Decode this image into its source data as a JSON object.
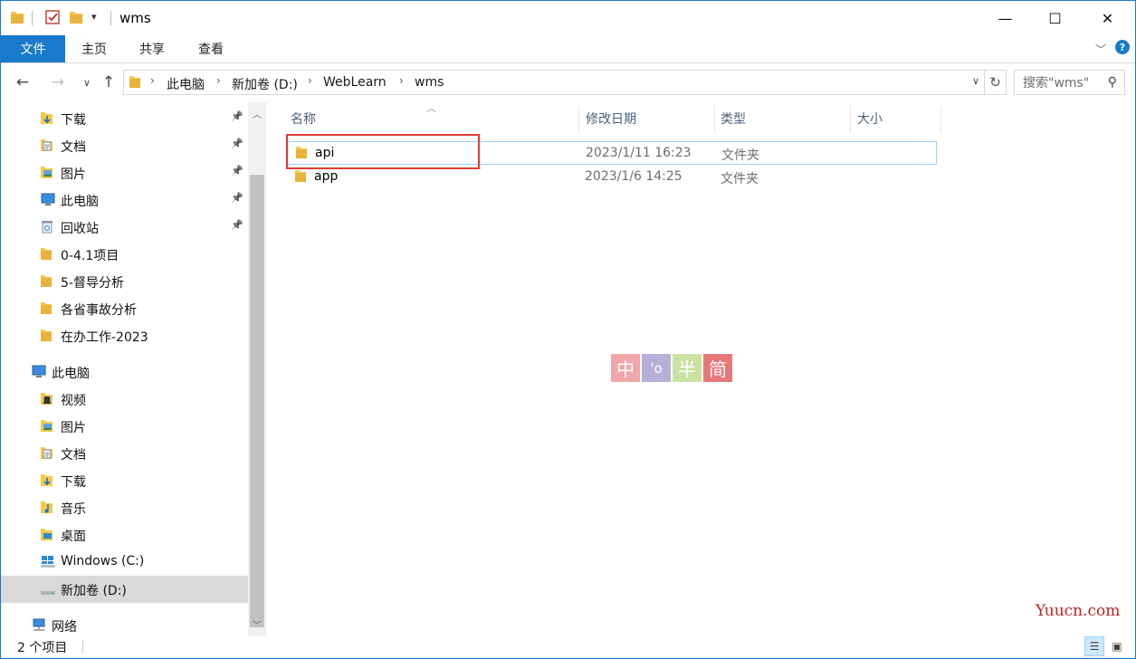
{
  "window": {
    "title": "wms",
    "controls": {
      "minimize": "—",
      "maximize": "☐",
      "close": "✕"
    }
  },
  "ribbon": {
    "tabs": [
      {
        "label": "文件",
        "active": true
      },
      {
        "label": "主页"
      },
      {
        "label": "共享"
      },
      {
        "label": "查看"
      }
    ]
  },
  "address": {
    "crumbs": [
      "此电脑",
      "新加卷 (D:)",
      "WebLearn",
      "wms"
    ],
    "search_placeholder": "搜索\"wms\""
  },
  "nav_pane": {
    "items": [
      {
        "label": "下载",
        "icon": "download-folder-icon",
        "pinned": true,
        "indent": 1
      },
      {
        "label": "文档",
        "icon": "documents-icon",
        "pinned": true,
        "indent": 1
      },
      {
        "label": "图片",
        "icon": "pictures-icon",
        "pinned": true,
        "indent": 1
      },
      {
        "label": "此电脑",
        "icon": "this-pc-icon",
        "pinned": true,
        "indent": 1
      },
      {
        "label": "回收站",
        "icon": "recycle-bin-icon",
        "pinned": true,
        "indent": 1
      },
      {
        "label": "0-4.1项目",
        "icon": "folder-icon",
        "indent": 1
      },
      {
        "label": "5-督导分析",
        "icon": "folder-icon",
        "indent": 1
      },
      {
        "label": "各省事故分析",
        "icon": "folder-icon",
        "indent": 1
      },
      {
        "label": "在办工作-2023",
        "icon": "folder-icon",
        "indent": 1
      },
      {
        "label": "此电脑",
        "icon": "this-pc-icon",
        "indent": 0,
        "gap": true
      },
      {
        "label": "视频",
        "icon": "videos-icon",
        "indent": 1
      },
      {
        "label": "图片",
        "icon": "pictures-icon",
        "indent": 1
      },
      {
        "label": "文档",
        "icon": "documents-icon",
        "indent": 1
      },
      {
        "label": "下载",
        "icon": "download-folder-icon",
        "indent": 1
      },
      {
        "label": "音乐",
        "icon": "music-icon",
        "indent": 1
      },
      {
        "label": "桌面",
        "icon": "desktop-icon",
        "indent": 1
      },
      {
        "label": "Windows  (C:)",
        "icon": "windows-drive-icon",
        "indent": 1
      },
      {
        "label": "新加卷 (D:)",
        "icon": "drive-icon",
        "indent": 1,
        "selected": true
      },
      {
        "label": "网络",
        "icon": "network-icon",
        "indent": 0,
        "gap": true
      }
    ]
  },
  "columns": {
    "name": "名称",
    "modified": "修改日期",
    "type": "类型",
    "size": "大小"
  },
  "files": [
    {
      "name": "api",
      "modified": "2023/1/11 16:23",
      "type": "文件夹"
    },
    {
      "name": "app",
      "modified": "2023/1/6 14:25",
      "type": "文件夹"
    }
  ],
  "ime_badge": [
    "中",
    "'o",
    "半",
    "简"
  ],
  "ime_colors": [
    "#f0a6a8",
    "#b5b0d8",
    "#c9e3a3",
    "#e77878"
  ],
  "watermark": "Yuucn.com",
  "status": {
    "item_count": "2 个项目"
  },
  "colors": {
    "accent": "#1979ca",
    "highlight_box": "#e23b3b",
    "folder": "#f5c84c"
  }
}
